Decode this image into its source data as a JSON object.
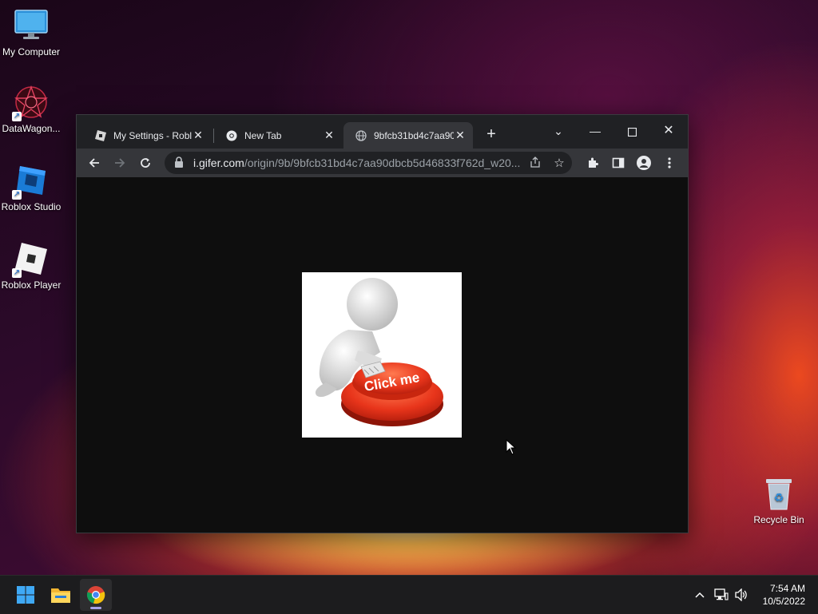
{
  "desktop": {
    "icons": [
      {
        "label": "My Computer"
      },
      {
        "label": "DataWagon..."
      },
      {
        "label": "Roblox Studio"
      },
      {
        "label": "Roblox Player"
      },
      {
        "label": "Recycle Bin"
      }
    ]
  },
  "browser": {
    "tabs": [
      {
        "title": "My Settings - Roblox",
        "favicon": "roblox-icon",
        "active": false
      },
      {
        "title": "New Tab",
        "favicon": "chrome-icon",
        "active": false
      },
      {
        "title": "9bfcb31bd4c7aa90",
        "favicon": "globe-icon",
        "active": true
      }
    ],
    "address": {
      "host": "i.gifer.com",
      "path": "/origin/9b/9bfcb31bd4c7aa90dbcb5d46833f762d_w20..."
    },
    "content": {
      "image_alt": "Click me",
      "button_text": "Click me",
      "background_color": "#0e0e0e"
    }
  },
  "taskbar": {
    "time": "7:54 AM",
    "date": "10/5/2022",
    "apps": [
      "start-icon",
      "file-explorer-icon",
      "chrome-icon"
    ]
  },
  "colors": {
    "accent": "#a7a3e8",
    "chrome_dark": "#202124",
    "chrome_toolbar": "#35363a"
  }
}
